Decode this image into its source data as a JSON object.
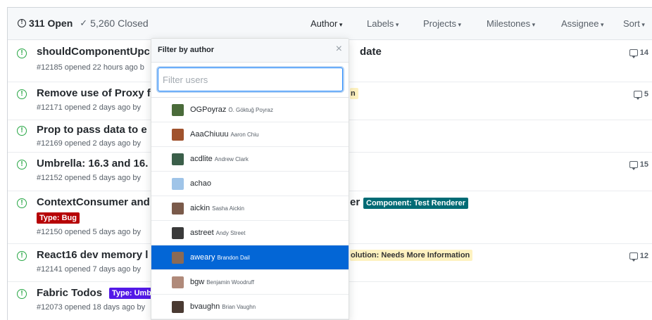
{
  "header": {
    "open_count": "311 Open",
    "closed_count": "5,260 Closed",
    "filters": [
      "Author",
      "Labels",
      "Projects",
      "Milestones",
      "Assignee",
      "Sort"
    ]
  },
  "issues": [
    {
      "title_visible": "shouldComponentUpc",
      "title_tail": "date",
      "meta": "#12185 opened 22 hours ago b",
      "comments": "14"
    },
    {
      "title_visible": "Remove use of Proxy f",
      "label_tail": "n",
      "meta": "#12171 opened 2 days ago by",
      "comments": "5"
    },
    {
      "title_visible": "Prop to pass data to e",
      "meta": "#12169 opened 2 days ago by",
      "comments": ""
    },
    {
      "title_visible": "Umbrella: 16.3 and 16.",
      "meta": "#12152 opened 5 days ago by",
      "comments": "15"
    },
    {
      "title_visible": "ContextConsumer and",
      "title_tail": "er",
      "label_tail": "Component: Test Renderer",
      "label_bug": "Type: Bug",
      "meta": "#12150 opened 5 days ago by",
      "comments": ""
    },
    {
      "title_visible": "React16 dev memory l",
      "label_tail": "olution: Needs More Information",
      "meta": "#12141 opened 7 days ago by",
      "comments": "12"
    },
    {
      "title_visible": "Fabric Todos",
      "label_umb": "Type: Umb",
      "meta": "#12073 opened 18 days ago by",
      "comments": ""
    }
  ],
  "author_menu": {
    "title": "Filter by author",
    "close": "×",
    "placeholder": "Filter users",
    "users": [
      {
        "login": "OGPoyraz",
        "name": "Ö. Göktuğ Poyraz",
        "avatar_color": "#4a6b3a"
      },
      {
        "login": "AaaChiuuu",
        "name": "Aaron Chiu",
        "avatar_color": "#a0522d"
      },
      {
        "login": "acdlite",
        "name": "Andrew Clark",
        "avatar_color": "#3b5f4a"
      },
      {
        "login": "achao",
        "name": "",
        "avatar_color": "#9fc4e8"
      },
      {
        "login": "aickin",
        "name": "Sasha Aickin",
        "avatar_color": "#7a5a4a"
      },
      {
        "login": "astreet",
        "name": "Andy Street",
        "avatar_color": "#3a3a3a"
      },
      {
        "login": "aweary",
        "name": "Brandon Dail",
        "avatar_color": "#8a6a55",
        "selected": true
      },
      {
        "login": "bgw",
        "name": "Benjamin Woodruff",
        "avatar_color": "#b08a7a"
      },
      {
        "login": "bvaughn",
        "name": "Brian Vaughn",
        "avatar_color": "#4a3a32"
      }
    ]
  }
}
